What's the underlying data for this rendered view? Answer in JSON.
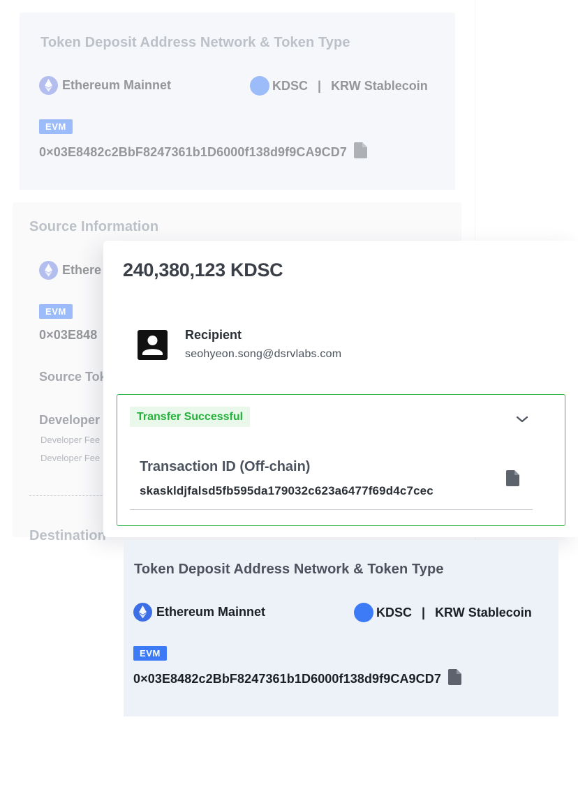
{
  "background_card": {
    "deposit_section": {
      "title": "Token Deposit Address Network & Token Type",
      "network": "Ethereum Mainnet",
      "token_symbol": "KDSC",
      "separator": "|",
      "token_name": "KRW Stablecoin",
      "tag": "EVM",
      "address": "0×03E8482c2BbF8247361b1D6000f138d9f9CA9CD7"
    },
    "source_section": {
      "title": "Source Information",
      "network_partial": "Ethere",
      "tag": "EVM",
      "address_partial": "0×03E848",
      "source_token_partial": "Source Tok",
      "developer_partial": "Developer",
      "developer_fee_1_partial": "Developer Fee",
      "developer_fee_2_partial": "Developer Fee",
      "destination_partial": "Destination"
    }
  },
  "modal": {
    "amount": "240,380,123 KDSC",
    "recipient_label": "Recipient",
    "recipient_email": "seohyeon.song@dsrvlabs.com",
    "status": "Transfer Successful",
    "tx_label": "Transaction ID (Off-chain)",
    "tx_id": "skaskldjfalsd5fb595da179032c623a6477f69d4c7cec"
  },
  "bottom_card": {
    "title": "Token Deposit Address Network & Token Type",
    "network": "Ethereum Mainnet",
    "token_symbol": "KDSC",
    "separator": "|",
    "token_name": "KRW Stablecoin",
    "tag": "EVM",
    "address": "0×03E8482c2BbF8247361b1D6000f138d9f9CA9CD7"
  },
  "icons": {
    "network": "ethereum-icon",
    "token": "kdsc-coin-icon",
    "copy": "document-icon",
    "recipient": "user-avatar-icon",
    "expand": "chevron-down-icon"
  },
  "colors": {
    "accent_blue": "#3c7bf5",
    "success_green": "#39b54a",
    "card_bg": "#edf1f8"
  }
}
